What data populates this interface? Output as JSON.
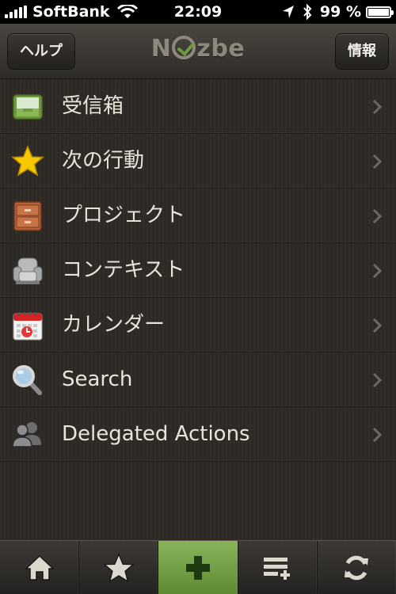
{
  "status_bar": {
    "carrier": "SoftBank",
    "time": "22:09",
    "battery": "99 %",
    "battery_level": 0.99
  },
  "navbar": {
    "help_label": "ヘルプ",
    "logo_text": "Nozbe",
    "info_label": "情報"
  },
  "menu": {
    "items": [
      {
        "label": "受信箱",
        "icon": "inbox-tray-icon"
      },
      {
        "label": "次の行動",
        "icon": "star-icon"
      },
      {
        "label": "プロジェクト",
        "icon": "drawer-cabinet-icon"
      },
      {
        "label": "コンテキスト",
        "icon": "armchair-icon"
      },
      {
        "label": "カレンダー",
        "icon": "calendar-icon"
      },
      {
        "label": "Search",
        "icon": "magnifier-icon"
      },
      {
        "label": "Delegated Actions",
        "icon": "people-icon"
      }
    ]
  },
  "tabbar": {
    "tabs": [
      {
        "name": "home",
        "icon": "home-icon"
      },
      {
        "name": "starred",
        "icon": "star-icon"
      },
      {
        "name": "add",
        "icon": "plus-icon"
      },
      {
        "name": "add-list",
        "icon": "list-add-icon"
      },
      {
        "name": "sync",
        "icon": "sync-icon"
      }
    ]
  },
  "colors": {
    "background": "#2d2a26",
    "text": "#e8e4da",
    "accent_green": "#6f9a3f",
    "logo_gray": "#8d887b"
  }
}
